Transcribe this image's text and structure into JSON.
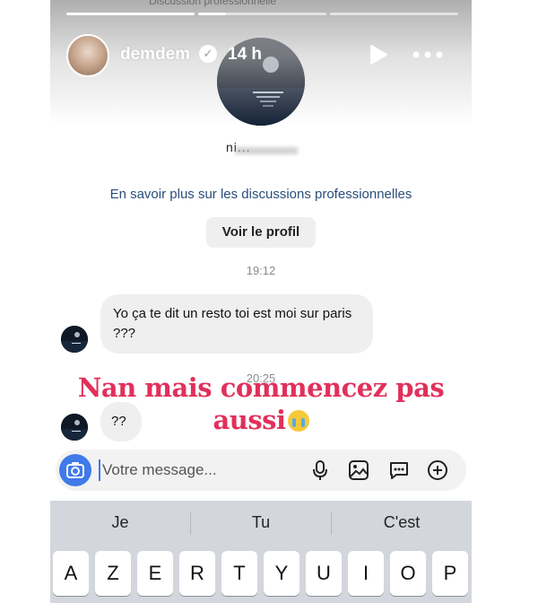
{
  "story": {
    "top_hidden_label": "Discussion professionnelle",
    "username": "demdem",
    "verified_glyph": "✓",
    "time_ago": "14 h",
    "progress_segments": 3,
    "progress_active_fraction": 0.22
  },
  "conversation": {
    "profile_name": "ni...",
    "learn_more_link": "En savoir plus sur les discussions professionnelles",
    "view_profile_button": "Voir le profil",
    "messages": [
      {
        "timestamp": "19:12",
        "text": "Yo ça te dit un resto toi est moi sur paris ???"
      },
      {
        "timestamp": "20:25",
        "text": "??"
      }
    ]
  },
  "overlay": {
    "line1": "Nan mais commencez pas",
    "line2": "aussi",
    "emoji": "loudly-crying-face"
  },
  "composer": {
    "placeholder": "Votre message..."
  },
  "keyboard": {
    "suggestions": [
      "Je",
      "Tu",
      "C'est"
    ],
    "row1": [
      "A",
      "Z",
      "E",
      "R",
      "T",
      "Y",
      "U",
      "I",
      "O",
      "P"
    ]
  },
  "colors": {
    "link": "#2a4e7a",
    "overlay_text": "#e1305b",
    "accent_blue": "#3f7ae8",
    "bubble": "#efefef",
    "keyboard_bg": "#d3d6dc"
  }
}
